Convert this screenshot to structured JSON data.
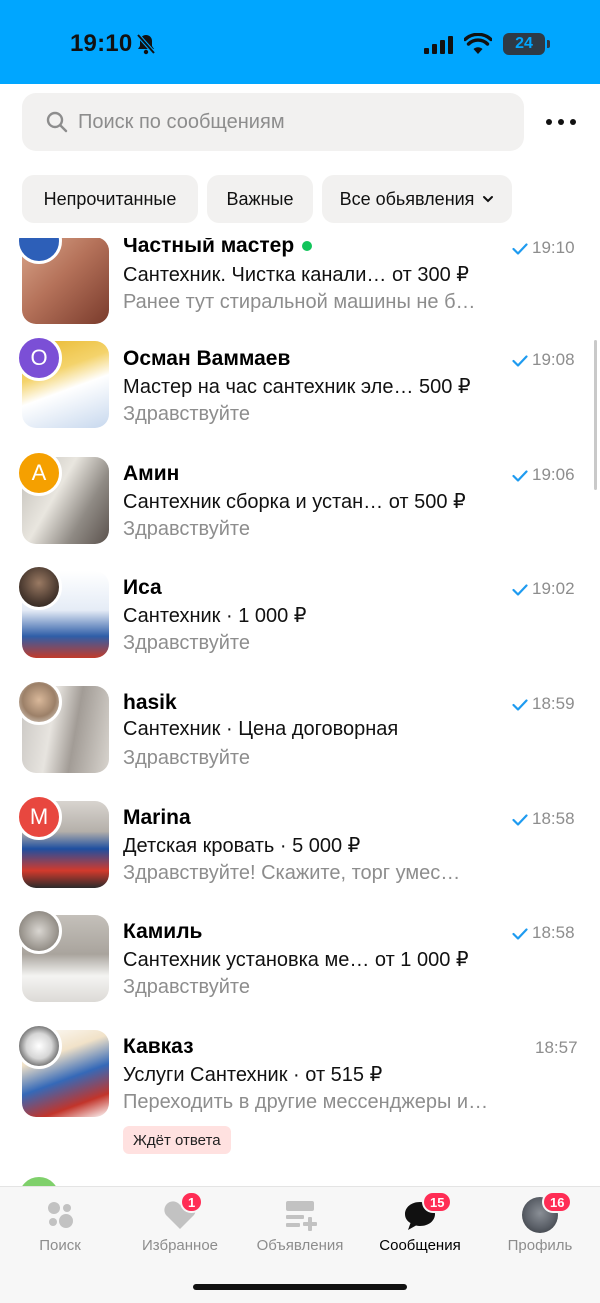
{
  "status_bar": {
    "time": "19:10",
    "battery": "24"
  },
  "search": {
    "placeholder": "Поиск по сообщениям"
  },
  "filters": [
    {
      "label": "Непрочитанные"
    },
    {
      "label": "Важные"
    },
    {
      "label": "Все обьявления"
    }
  ],
  "chats": [
    {
      "name": "Частный мастер",
      "ad": "Сантехник. Чистка канали…  от 300 ₽",
      "preview": "Ранее тут стиральной машины не б…",
      "time": "19:10",
      "read": true,
      "online": true
    },
    {
      "name": "Осман Ваммаев",
      "ad": "Мастер на час сантехник эле… 500 ₽",
      "preview": "Здравствуйте",
      "time": "19:08",
      "read": true,
      "avatar_letter": "О",
      "avatar_color": "#7b4fd6"
    },
    {
      "name": "Амин",
      "ad": "Сантехник сборка и устан…  от 500 ₽",
      "preview": "Здравствуйте",
      "time": "19:06",
      "read": true,
      "avatar_letter": "А",
      "avatar_color": "#f5a000"
    },
    {
      "name": "Иса",
      "ad": "Сантехник · 1 000 ₽",
      "preview": "Здравствуйте",
      "time": "19:02",
      "read": true
    },
    {
      "name": "hasik",
      "ad": "Сантехник · Цена договорная",
      "preview": "Здравствуйте",
      "time": "18:59",
      "read": true
    },
    {
      "name": "Marina",
      "ad": "Детская кровать · 5 000 ₽",
      "preview": "Здравствуйте! Скажите, торг умес…",
      "time": "18:58",
      "read": true,
      "avatar_letter": "M",
      "avatar_color": "#e8473f"
    },
    {
      "name": "Камиль",
      "ad": "Сантехник установка ме…  от 1 000 ₽",
      "preview": "Здравствуйте",
      "time": "18:58",
      "read": true
    },
    {
      "name": "Кавказ",
      "ad": "Услуги Сантехник · от 515 ₽",
      "preview": "Переходить в другие мессенджеры и…",
      "time": "18:57",
      "read": false,
      "badge": "Ждёт ответа"
    }
  ],
  "tabs": [
    {
      "label": "Поиск",
      "icon": "search-dots-icon"
    },
    {
      "label": "Избранное",
      "icon": "heart-icon",
      "badge": "1"
    },
    {
      "label": "Объявления",
      "icon": "add-listing-icon"
    },
    {
      "label": "Сообщения",
      "icon": "chat-bubble-icon",
      "badge": "15",
      "active": true
    },
    {
      "label": "Профиль",
      "icon": "profile-avatar-icon",
      "badge": "16"
    }
  ],
  "colors": {
    "status_bar": "#00a6ff",
    "badge": "#ff2d55",
    "read_check": "#1e9bf0",
    "online": "#11c45a",
    "wait_badge_bg": "#ffe1e0"
  }
}
